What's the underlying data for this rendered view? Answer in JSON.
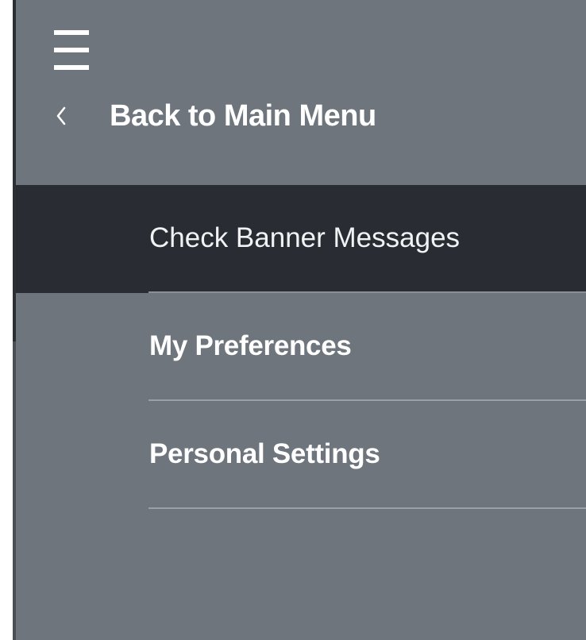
{
  "nav": {
    "menu_icon": "hamburger-icon",
    "back": {
      "icon": "chevron-left-icon",
      "label": "Back to Main Menu"
    },
    "items": [
      {
        "label": "Check Banner Messages",
        "active": true
      },
      {
        "label": "My Preferences",
        "active": false
      },
      {
        "label": "Personal Settings",
        "active": false
      }
    ]
  },
  "colors": {
    "panel_bg": "#6e757c",
    "active_item_bg": "#292d33",
    "text": "#ffffff",
    "divider": "#9aa0a6"
  }
}
